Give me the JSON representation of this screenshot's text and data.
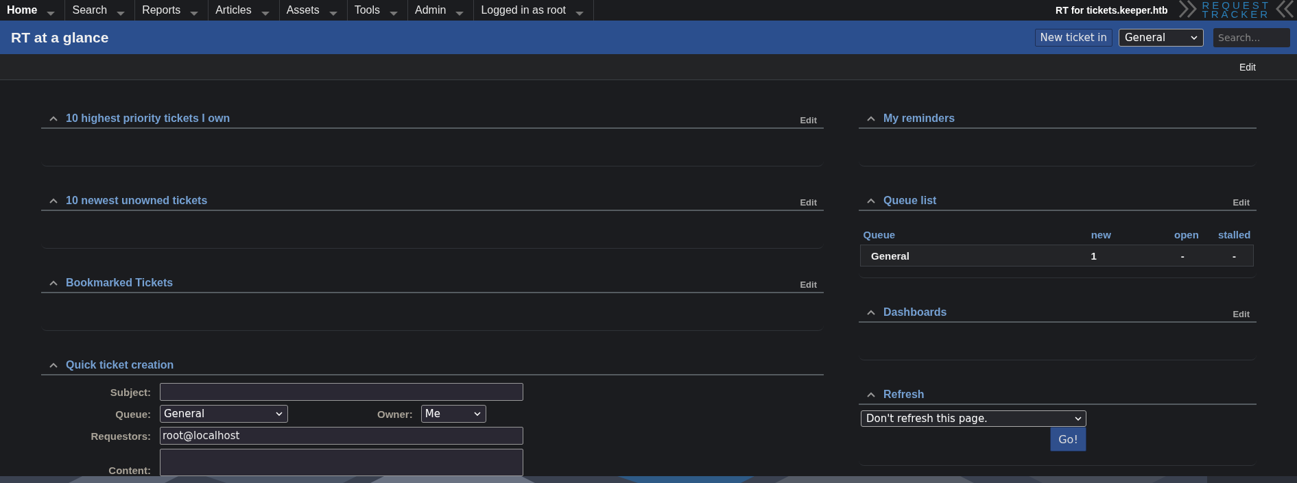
{
  "nav": {
    "items": [
      {
        "label": "Home",
        "selected": true
      },
      {
        "label": "Search",
        "selected": false
      },
      {
        "label": "Reports",
        "selected": false
      },
      {
        "label": "Articles",
        "selected": false
      },
      {
        "label": "Assets",
        "selected": false
      },
      {
        "label": "Tools",
        "selected": false
      },
      {
        "label": "Admin",
        "selected": false
      },
      {
        "label": "Logged in as root",
        "selected": false
      }
    ],
    "site_title": "RT for tickets.keeper.htb",
    "logo": {
      "line_1": "REQUEST",
      "line_2": "TRACKER"
    }
  },
  "header": {
    "title": "RT at a glance",
    "new_ticket_button": "New ticket in",
    "queue_select": "General",
    "search": {
      "placeholder": "Search..."
    }
  },
  "page_menu": {
    "edit": "Edit"
  },
  "left_column": [
    {
      "kind": "empty",
      "title": "10 highest priority tickets I own",
      "edit": "Edit"
    },
    {
      "kind": "empty",
      "title": "10 newest unowned tickets",
      "edit": "Edit"
    },
    {
      "kind": "empty",
      "title": "Bookmarked Tickets",
      "edit": "Edit"
    },
    {
      "kind": "form",
      "title": "Quick ticket creation",
      "form": {
        "subject": {
          "label": "Subject:"
        },
        "queue": {
          "label": "Queue:",
          "value": "General"
        },
        "owner": {
          "label": "Owner:",
          "value": "Me"
        },
        "requestors": {
          "label": "Requestors:",
          "value": "root@localhost"
        },
        "content": {
          "label": "Content:"
        }
      }
    }
  ],
  "right_column": [
    {
      "kind": "empty",
      "title": "My reminders"
    },
    {
      "kind": "queue_list",
      "title": "Queue list",
      "edit": "Edit",
      "table": {
        "columns": [
          "Queue",
          "new",
          "open",
          "stalled"
        ],
        "rows": [
          [
            "General",
            "1",
            "-",
            "-"
          ]
        ]
      }
    },
    {
      "kind": "empty",
      "title": "Dashboards",
      "edit": "Edit"
    },
    {
      "kind": "refresh",
      "title": "Refresh",
      "select": "Don't refresh this page.",
      "button": "Go!"
    }
  ]
}
